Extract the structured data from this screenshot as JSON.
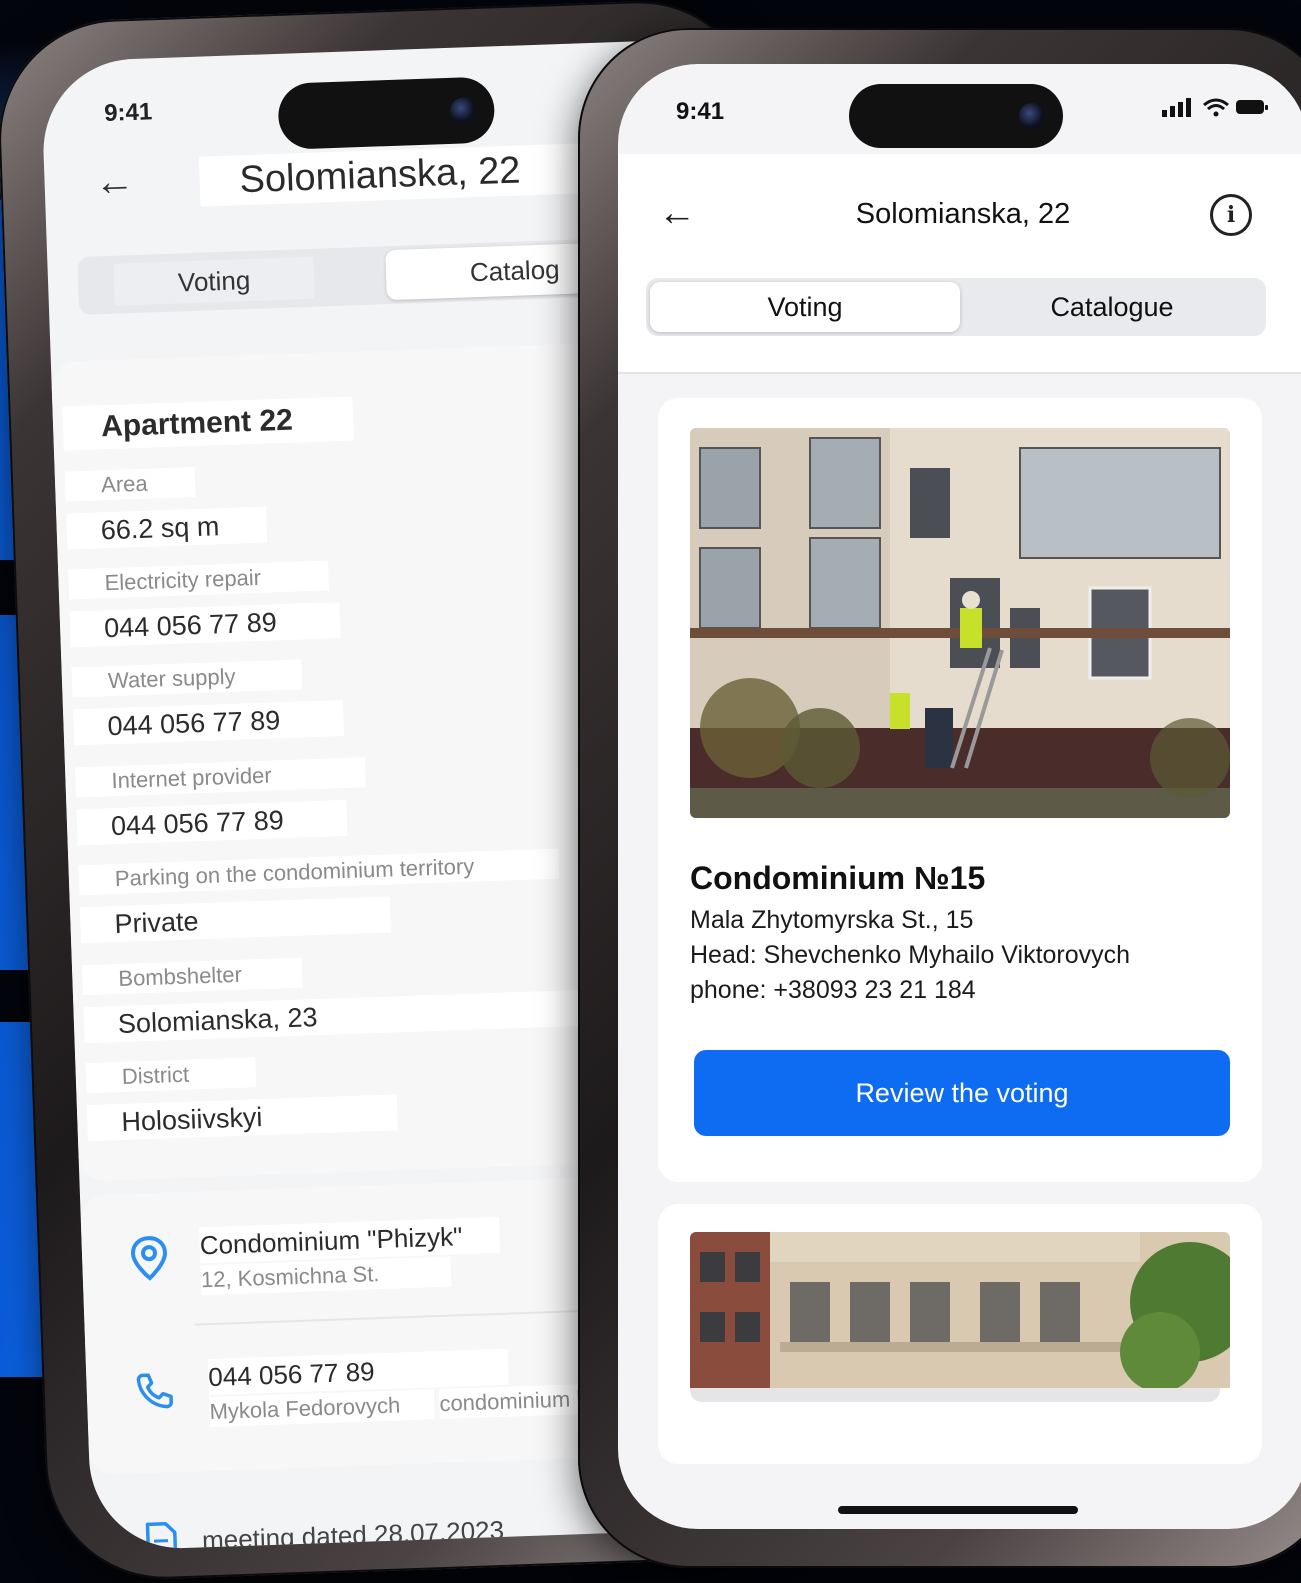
{
  "back_phone": {
    "status_time": "9:41",
    "title": "Solomianska, 22",
    "segments": [
      "Voting",
      "Catalog"
    ],
    "apartment_title": "Apartment 22",
    "fields": [
      {
        "label": "Area",
        "value": "66.2 sq m"
      },
      {
        "label": "Electricity repair",
        "value": "044 056 77 89"
      },
      {
        "label": "Water supply",
        "value": "044 056 77 89"
      },
      {
        "label": "Internet provider",
        "value": "044 056 77 89"
      },
      {
        "label": "Parking on the condominium territory",
        "value": "Private"
      },
      {
        "label": "Bombshelter",
        "value": "Solomianska, 23"
      },
      {
        "label": "District",
        "value": "Holosiivskyi"
      }
    ],
    "condominium": {
      "name": "Condominium \"Phizyk\"",
      "address": "12, Kosmichna St."
    },
    "contact": {
      "phone": "044 056 77 89",
      "person": "Mykola Fedorovych",
      "role": "condominium he"
    },
    "document": "meeting dated 28.07.2023"
  },
  "front_phone": {
    "status_time": "9:41",
    "title": "Solomianska, 22",
    "tabs": [
      "Voting",
      "Catalogue"
    ],
    "card": {
      "name": "Condominium №15",
      "address": "Mala Zhytomyrska St., 15",
      "head": "Head: Shevchenko Myhailo Viktorovych",
      "phone": "phone: +38093 23 21 184",
      "button": "Review the voting"
    }
  },
  "colors": {
    "accent": "#0d6cf2",
    "icon_blue": "#2a8ff0",
    "background": "#03050c"
  }
}
